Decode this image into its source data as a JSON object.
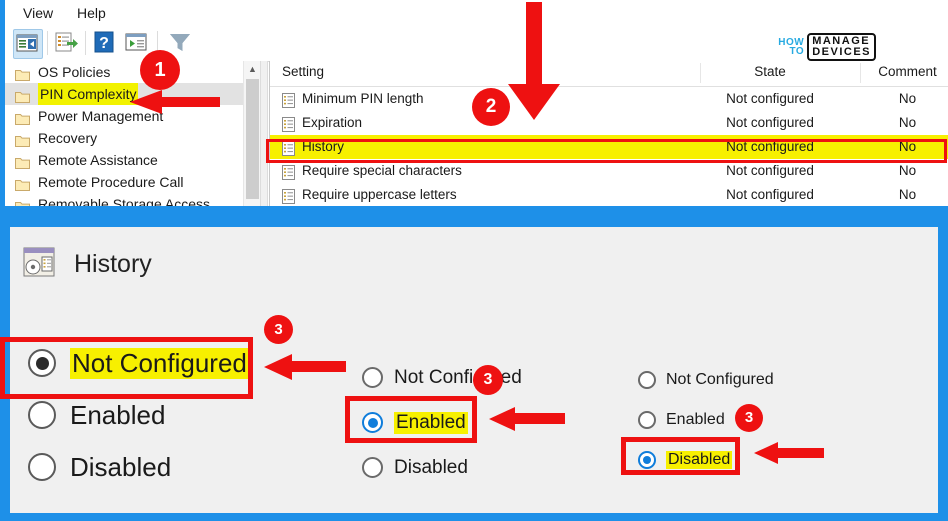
{
  "window": {
    "menu": {
      "view": "View",
      "help": "Help"
    },
    "toolbar_icons": [
      "show-hide-console-tree-icon",
      "export-list-icon",
      "help-icon",
      "properties-icon",
      "filter-icon"
    ]
  },
  "logo": {
    "how": "HOW",
    "to": "TO",
    "manage": "MANAGE",
    "devices": "DEVICES"
  },
  "tree": {
    "items": [
      {
        "label": "OS Policies",
        "selected": false
      },
      {
        "label": "PIN Complexity",
        "selected": true
      },
      {
        "label": "Power Management",
        "selected": false
      },
      {
        "label": "Recovery",
        "selected": false
      },
      {
        "label": "Remote Assistance",
        "selected": false
      },
      {
        "label": "Remote Procedure Call",
        "selected": false
      },
      {
        "label": "Removable Storage Access",
        "selected": false
      }
    ]
  },
  "settings_list": {
    "columns": [
      "Setting",
      "State",
      "Comment"
    ],
    "rows": [
      {
        "setting": "Minimum PIN length",
        "state": "Not configured",
        "comment": "No",
        "highlighted": false
      },
      {
        "setting": "Expiration",
        "state": "Not configured",
        "comment": "No",
        "highlighted": false
      },
      {
        "setting": "History",
        "state": "Not configured",
        "comment": "No",
        "highlighted": true
      },
      {
        "setting": "Require special characters",
        "state": "Not configured",
        "comment": "No",
        "highlighted": false
      },
      {
        "setting": "Require uppercase letters",
        "state": "Not configured",
        "comment": "No",
        "highlighted": false
      }
    ]
  },
  "dialog": {
    "title": "History",
    "group1": {
      "options": [
        {
          "label": "Not Configured",
          "selected": true,
          "highlighted": true
        },
        {
          "label": "Enabled",
          "selected": false,
          "highlighted": false
        },
        {
          "label": "Disabled",
          "selected": false,
          "highlighted": false
        }
      ]
    },
    "group2": {
      "options": [
        {
          "label": "Not Configured",
          "selected": false,
          "highlighted": false
        },
        {
          "label": "Enabled",
          "selected": true,
          "highlighted": true
        },
        {
          "label": "Disabled",
          "selected": false,
          "highlighted": false
        }
      ]
    },
    "group3": {
      "options": [
        {
          "label": "Not Configured",
          "selected": false,
          "highlighted": false
        },
        {
          "label": "Enabled",
          "selected": false,
          "highlighted": false
        },
        {
          "label": "Disabled",
          "selected": true,
          "highlighted": true
        }
      ]
    }
  },
  "annotations": {
    "badges": [
      {
        "id": "1",
        "label": "1"
      },
      {
        "id": "2",
        "label": "2"
      },
      {
        "id": "3a",
        "label": "3"
      },
      {
        "id": "3b",
        "label": "3"
      },
      {
        "id": "3c",
        "label": "3"
      }
    ]
  },
  "colors": {
    "accent_blue": "#1e90e8",
    "annotation_red": "#ee1111",
    "highlight_yellow": "#f7f000",
    "radio_blue": "#0f7ddb"
  }
}
